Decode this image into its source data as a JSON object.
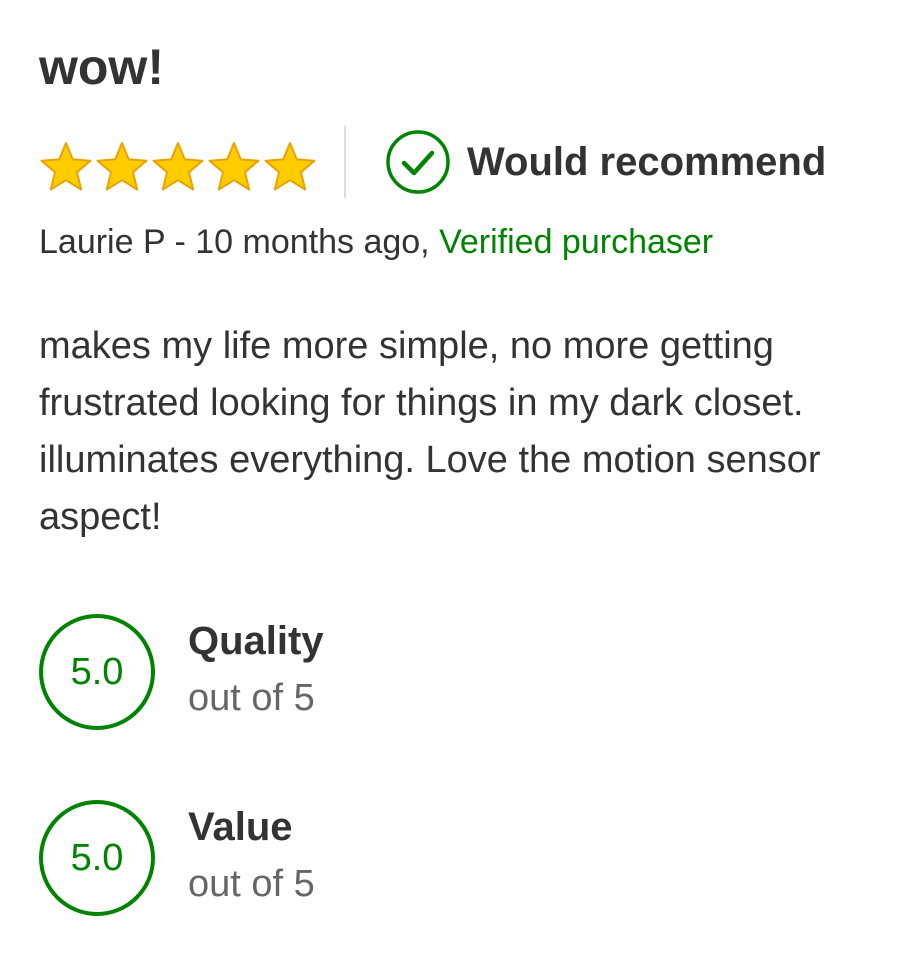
{
  "review": {
    "title": "wow!",
    "rating": {
      "stars_filled": 5,
      "stars_total": 5,
      "star_color": "#FFCC00",
      "star_outline_color": "#E8A300"
    },
    "recommend": {
      "label": "Would recommend",
      "icon": "check-circle-icon",
      "color": "#008300"
    },
    "meta": {
      "author_time": "Laurie P - 10 months ago,",
      "verified": "Verified purchaser"
    },
    "body": "makes my life more simple, no more getting frustrated looking for things in my dark closet. illuminates everything. Love the motion sensor aspect!",
    "scores": [
      {
        "value": "5.0",
        "label": "Quality",
        "sub": "out of 5"
      },
      {
        "value": "5.0",
        "label": "Value",
        "sub": "out of 5"
      }
    ]
  },
  "colors": {
    "accent_green": "#008300",
    "text_primary": "#333333",
    "text_secondary": "#666666",
    "divider": "#DDDDDD"
  }
}
